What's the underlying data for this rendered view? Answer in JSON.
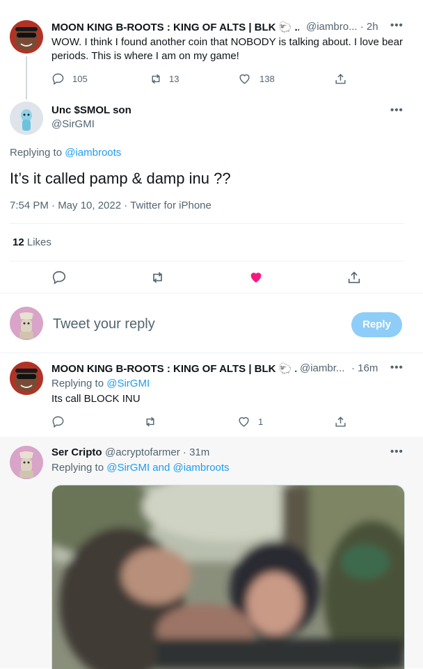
{
  "tweet1": {
    "name": "MOON KING B-ROOTS : KING OF ALTS | BLK 🐑 ...",
    "handle_time": "@iambro... · 2h",
    "text": "WOW. I think I found another coin that NOBODY is talking about. I love bear periods. This is where I am on my game!",
    "replies": "105",
    "retweets": "13",
    "likes": "138"
  },
  "main": {
    "name": "Unc $SMOL son",
    "handle": "@SirGMI",
    "replying_prefix": "Replying to",
    "replying_to": "@iambroots",
    "text": "It’s it called pamp & damp inu ??",
    "meta": "7:54 PM · May 10, 2022 · Twitter for iPhone",
    "likes_count": "12",
    "likes_label": "Likes"
  },
  "compose": {
    "placeholder": "Tweet your reply",
    "button": "Reply"
  },
  "reply1": {
    "name": "MOON KING B-ROOTS : KING OF ALTS | BLK 🐑 ...",
    "handle": "@iambr...",
    "time": "· 16m",
    "replying_prefix": "Replying to",
    "replying_to": "@SirGMI",
    "text": "Its call BLOCK INU",
    "likes": "1"
  },
  "reply2": {
    "name": "Ser Cripto",
    "handle_time": "@acryptofarmer · 31m",
    "replying_prefix": "Replying to",
    "replying_to": "@SirGMI and @iambroots"
  },
  "icons": {
    "more": "•••"
  },
  "colors": {
    "accent": "#1d9bf0",
    "like_active": "#f91880",
    "reply_button_disabled": "#8ecdf8",
    "muted": "#536471"
  }
}
